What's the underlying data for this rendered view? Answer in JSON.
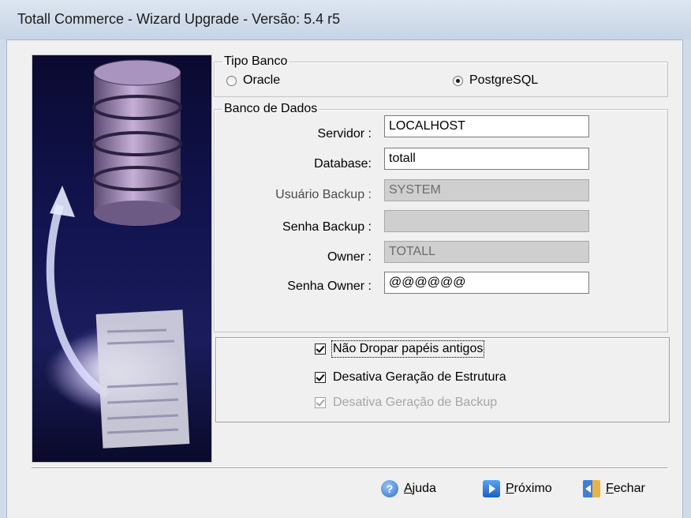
{
  "window": {
    "title": "Totall Commerce - Wizard Upgrade - Versão: 5.4 r5"
  },
  "tipo_banco": {
    "legend": "Tipo Banco",
    "options": [
      {
        "label": "Oracle",
        "selected": false
      },
      {
        "label": "PostgreSQL",
        "selected": true
      }
    ]
  },
  "banco_dados": {
    "legend": "Banco de Dados",
    "fields": [
      {
        "label": "Servidor :",
        "value": "LOCALHOST",
        "enabled": true
      },
      {
        "label": "Database:",
        "value": "totall",
        "enabled": true
      },
      {
        "label": "Usuário Backup :",
        "value": "SYSTEM",
        "enabled": false
      },
      {
        "label": "Senha Backup :",
        "value": "",
        "enabled": false
      },
      {
        "label": "Owner :",
        "value": "TOTALL",
        "enabled": false
      },
      {
        "label": "Senha Owner :",
        "value": "@@@@@@",
        "enabled": true
      }
    ]
  },
  "options": [
    {
      "label": "Não Dropar papéis antigos",
      "checked": true,
      "enabled": true
    },
    {
      "label": "Desativa Geração de Estrutura",
      "checked": true,
      "enabled": true
    },
    {
      "label": "Desativa Geração de Backup",
      "checked": true,
      "enabled": false
    }
  ],
  "buttons": {
    "help": {
      "accel": "A",
      "rest": "juda"
    },
    "next": {
      "accel": "P",
      "rest": "róximo"
    },
    "close": {
      "accel": "F",
      "rest": "echar"
    }
  }
}
